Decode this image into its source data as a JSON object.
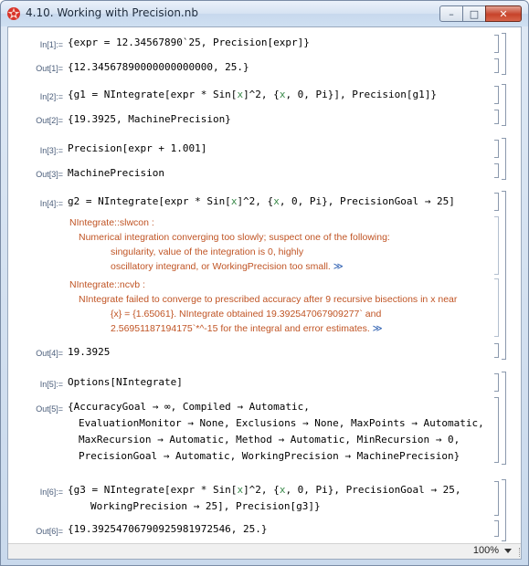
{
  "window": {
    "title": "4.10. Working with Precision.nb",
    "btn_min": "–",
    "btn_max": "□",
    "btn_close": "✕"
  },
  "icons": {
    "app": "mathematica-spikey-icon",
    "more": "double-chevron-right-icon"
  },
  "colors": {
    "label": "#4a5d7a",
    "message": "#c05424",
    "link": "#2a5db0",
    "variable": "#3b8b4b"
  },
  "cells": {
    "in1": {
      "label": "In[1]:=",
      "line1": "{expr = 12.34567890`25, Precision[expr]}"
    },
    "out1": {
      "label": "Out[1]=",
      "line1": "{12.34567890000000000000, 25.}"
    },
    "in2": {
      "label": "In[2]:=",
      "pre": "{g1 = NIntegrate[expr * Sin[",
      "v1": "x",
      "mid": "]^2, {",
      "v2": "x",
      "post": ", 0, Pi}], Precision[g1]}"
    },
    "out2": {
      "label": "Out[2]=",
      "line1": "{19.3925, MachinePrecision}"
    },
    "in3": {
      "label": "In[3]:=",
      "line1": "Precision[expr + 1.001]"
    },
    "out3": {
      "label": "Out[3]=",
      "line1": "MachinePrecision"
    },
    "in4": {
      "label": "In[4]:=",
      "pre": "g2 = NIntegrate[expr * Sin[",
      "v1": "x",
      "mid": "]^2, {",
      "v2": "x",
      "post": ", 0, Pi}, PrecisionGoal → 25]"
    },
    "msg1": {
      "head": "NIntegrate::slwcon :",
      "line1": "Numerical integration converging too slowly; suspect one of the following:",
      "line2": "singularity, value of the integration is 0, highly",
      "line3": "oscillatory integrand, or WorkingPrecision too small.",
      "more": "≫"
    },
    "msg2": {
      "head": "NIntegrate::ncvb :",
      "line1": "NIntegrate failed to converge to prescribed accuracy after 9 recursive bisections in x near",
      "line2": "{x} = {1.65061}. NIntegrate obtained 19.392547067909277` and",
      "line3": "2.56951187194175`*^-15 for the integral and error estimates.",
      "more": "≫"
    },
    "out4": {
      "label": "Out[4]=",
      "line1": "19.3925"
    },
    "in5": {
      "label": "In[5]:=",
      "line1": "Options[NIntegrate]"
    },
    "out5": {
      "label": "Out[5]=",
      "line1": "{AccuracyGoal → ∞, Compiled → Automatic,",
      "line2": "EvaluationMonitor → None, Exclusions → None, MaxPoints → Automatic,",
      "line3": "MaxRecursion → Automatic, Method → Automatic, MinRecursion → 0,",
      "line4": "PrecisionGoal → Automatic, WorkingPrecision → MachinePrecision}"
    },
    "in6": {
      "label": "In[6]:=",
      "pre": "{g3 = NIntegrate[expr * Sin[",
      "v1": "x",
      "mid": "]^2, {",
      "v2": "x",
      "post": ", 0, Pi}, PrecisionGoal → 25,",
      "line2": "WorkingPrecision → 25], Precision[g3]}"
    },
    "out6": {
      "label": "Out[6]=",
      "line1": "{19.39254706790925981972546, 25.}"
    }
  },
  "status": {
    "zoom": "100%"
  }
}
